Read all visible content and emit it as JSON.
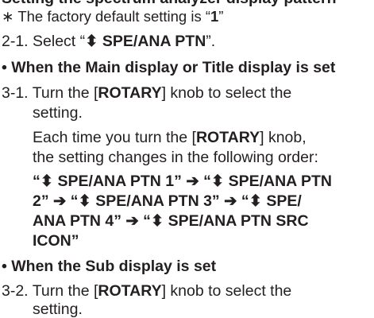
{
  "section_title": "Setting the spectrum analyzer display pattern",
  "note": {
    "asterisk": "∗",
    "text": "The factory default setting is “",
    "value": "1",
    "close": "”"
  },
  "steps": {
    "s2_1": {
      "num": "2-1.",
      "pre": "Select “",
      "glyph": "⬍",
      "bold": "SPE/ANA PTN",
      "post": "”."
    },
    "main_heading": "When the Main display or Title display is set",
    "s3_1": {
      "num": "3-1.",
      "line1_pre": "Turn the [",
      "rotary": "ROTARY",
      "line1_post": "] knob to select the",
      "line2": "setting.",
      "line3_pre": "Each time you turn the [",
      "line3_post": "] knob,",
      "line4": "the setting changes in the following order:",
      "seq": [
        "“⬍ SPE/ANA PTN 1” ➔ “⬍ SPE/ANA PTN",
        "2” ➔ “⬍ SPE/ANA PTN 3” ➔ “⬍ SPE/",
        "ANA PTN 4” ➔ “⬍ SPE/ANA PTN SRC",
        "ICON”"
      ]
    },
    "sub_heading": "When the Sub display is set",
    "s3_2": {
      "num": "3-2.",
      "line1_pre": "Turn the [",
      "rotary": "ROTARY",
      "line1_post": "] knob to select the",
      "line2": "setting."
    }
  }
}
